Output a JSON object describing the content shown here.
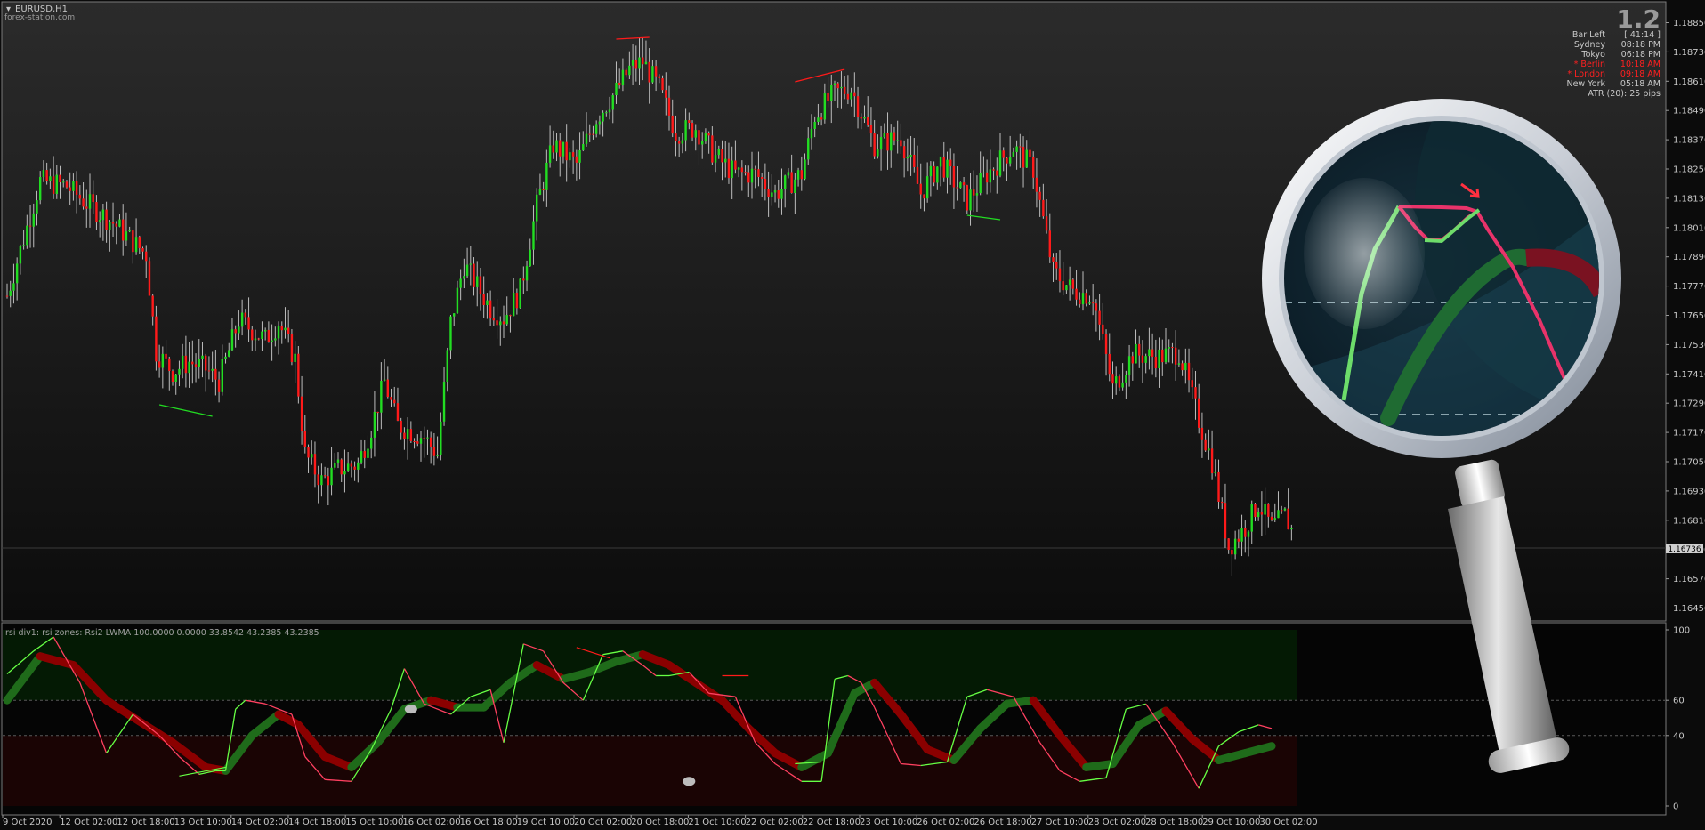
{
  "chart_title": "EURUSD,H1",
  "watermark": "forex-station.com",
  "version": "1.2",
  "info_panel": {
    "rows": [
      {
        "label": "Bar Left",
        "value": "[ 41:14 ]",
        "color": "#c8c8c8"
      },
      {
        "label": "Sydney",
        "value": "08:18 PM",
        "color": "#c8c8c8"
      },
      {
        "label": "Tokyo",
        "value": "06:18 PM",
        "color": "#c8c8c8"
      },
      {
        "label": "* Berlin",
        "value": "10:18 AM",
        "color": "#ff2020"
      },
      {
        "label": "* London",
        "value": "09:18 AM",
        "color": "#ff2020"
      },
      {
        "label": "New York",
        "value": "05:18 AM",
        "color": "#c8c8c8"
      }
    ],
    "atr": "ATR (20): 25 pips"
  },
  "current_price": "1.16736",
  "indicator_label": "rsi div1: rsi zones: Rsi2 LWMA 100.0000 0.0000 33.8542 43.2385 43.2385",
  "colors": {
    "bull": "#22dd22",
    "bear": "#ff1a1a",
    "rsi_fast": "#ff4060",
    "rsi_fast_up": "#66ff44",
    "rsi_slow_up": "#1f6b1a",
    "rsi_slow_down": "#8b0000",
    "bg_green_zone": "#041a04",
    "bg_red_zone": "#1a0404"
  },
  "chart_data": [
    {
      "type": "candlestick",
      "title": "EURUSD,H1",
      "y_ticks": [
        "1.18850",
        "1.18730",
        "1.18610",
        "1.18490",
        "1.18370",
        "1.18250",
        "1.18130",
        "1.18010",
        "1.17890",
        "1.17770",
        "1.17650",
        "1.17530",
        "1.17410",
        "1.17290",
        "1.17170",
        "1.17050",
        "1.16930",
        "1.16810",
        "1.16690",
        "1.16570",
        "1.16450"
      ],
      "ylim": [
        1.1645,
        1.1885
      ],
      "anchors": [
        [
          0,
          1.1773
        ],
        [
          10,
          1.182
        ],
        [
          18,
          1.1818
        ],
        [
          24,
          1.1811
        ],
        [
          32,
          1.1803
        ],
        [
          42,
          1.179
        ],
        [
          45,
          1.175
        ],
        [
          50,
          1.1742
        ],
        [
          55,
          1.1746
        ],
        [
          60,
          1.1743
        ],
        [
          64,
          1.1738
        ],
        [
          70,
          1.1763
        ],
        [
          78,
          1.1755
        ],
        [
          82,
          1.1762
        ],
        [
          87,
          1.1747
        ],
        [
          90,
          1.1708
        ],
        [
          95,
          1.1697
        ],
        [
          100,
          1.1702
        ],
        [
          106,
          1.1704
        ],
        [
          110,
          1.1719
        ],
        [
          114,
          1.1738
        ],
        [
          118,
          1.172
        ],
        [
          126,
          1.1715
        ],
        [
          130,
          1.1708
        ],
        [
          134,
          1.1762
        ],
        [
          138,
          1.1786
        ],
        [
          146,
          1.1768
        ],
        [
          150,
          1.1764
        ],
        [
          155,
          1.1775
        ],
        [
          160,
          1.181
        ],
        [
          165,
          1.1835
        ],
        [
          172,
          1.1827
        ],
        [
          178,
          1.1846
        ],
        [
          184,
          1.1857
        ],
        [
          188,
          1.1866
        ],
        [
          192,
          1.1869
        ],
        [
          197,
          1.1858
        ],
        [
          202,
          1.184
        ],
        [
          208,
          1.1842
        ],
        [
          214,
          1.183
        ],
        [
          220,
          1.1823
        ],
        [
          226,
          1.1823
        ],
        [
          232,
          1.1815
        ],
        [
          240,
          1.1823
        ],
        [
          244,
          1.1847
        ],
        [
          250,
          1.1856
        ],
        [
          255,
          1.1858
        ],
        [
          262,
          1.1835
        ],
        [
          270,
          1.1838
        ],
        [
          276,
          1.1815
        ],
        [
          282,
          1.1828
        ],
        [
          290,
          1.1812
        ],
        [
          296,
          1.1823
        ],
        [
          304,
          1.1834
        ],
        [
          310,
          1.1825
        ],
        [
          316,
          1.1783
        ],
        [
          322,
          1.1775
        ],
        [
          328,
          1.1773
        ],
        [
          334,
          1.1735
        ],
        [
          340,
          1.1749
        ],
        [
          348,
          1.1748
        ],
        [
          354,
          1.175
        ],
        [
          360,
          1.1722
        ],
        [
          364,
          1.1705
        ],
        [
          369,
          1.167
        ],
        [
          374,
          1.1678
        ],
        [
          378,
          1.1688
        ],
        [
          382,
          1.1678
        ],
        [
          386,
          1.1683
        ],
        [
          388,
          1.1677
        ]
      ],
      "last_price": "1.16736"
    },
    {
      "type": "line",
      "title": "rsi div1: rsi zones: Rsi2 LWMA 100.0000 0.0000 33.8542 43.2385 43.2385",
      "ylim": [
        0,
        100
      ],
      "y_ticks": [
        "100",
        "60",
        "40",
        "0"
      ],
      "levels": [
        60,
        40
      ],
      "x_ticks": [
        "9 Oct 2020",
        "12 Oct 02:00",
        "12 Oct 18:00",
        "13 Oct 10:00",
        "14 Oct 02:00",
        "14 Oct 18:00",
        "15 Oct 10:00",
        "16 Oct 02:00",
        "16 Oct 18:00",
        "19 Oct 10:00",
        "20 Oct 02:00",
        "20 Oct 18:00",
        "21 Oct 10:00",
        "22 Oct 02:00",
        "22 Oct 18:00",
        "23 Oct 10:00",
        "26 Oct 02:00",
        "26 Oct 18:00",
        "27 Oct 10:00",
        "28 Oct 02:00",
        "28 Oct 18:00",
        "29 Oct 10:00",
        "30 Oct 02:00"
      ],
      "rsi_fast": [
        [
          0,
          75
        ],
        [
          8,
          88
        ],
        [
          14,
          96
        ],
        [
          22,
          70
        ],
        [
          30,
          30
        ],
        [
          38,
          52
        ],
        [
          46,
          40
        ],
        [
          52,
          28
        ],
        [
          58,
          18
        ],
        [
          63,
          20
        ],
        [
          66,
          20
        ],
        [
          69,
          55
        ],
        [
          72,
          60
        ],
        [
          78,
          58
        ],
        [
          86,
          52
        ],
        [
          90,
          28
        ],
        [
          96,
          15
        ],
        [
          104,
          14
        ],
        [
          110,
          32
        ],
        [
          116,
          55
        ],
        [
          120,
          78
        ],
        [
          126,
          58
        ],
        [
          134,
          52
        ],
        [
          140,
          62
        ],
        [
          146,
          66
        ],
        [
          150,
          36
        ],
        [
          156,
          92
        ],
        [
          162,
          88
        ],
        [
          168,
          70
        ],
        [
          174,
          60
        ],
        [
          180,
          86
        ],
        [
          186,
          88
        ],
        [
          192,
          80
        ],
        [
          196,
          74
        ],
        [
          200,
          74
        ],
        [
          206,
          76
        ],
        [
          212,
          64
        ],
        [
          220,
          62
        ],
        [
          226,
          36
        ],
        [
          232,
          24
        ],
        [
          240,
          14
        ],
        [
          246,
          14
        ],
        [
          250,
          72
        ],
        [
          254,
          74
        ],
        [
          258,
          70
        ],
        [
          262,
          56
        ],
        [
          270,
          24
        ],
        [
          276,
          23
        ],
        [
          284,
          25
        ],
        [
          290,
          62
        ],
        [
          296,
          66
        ],
        [
          304,
          62
        ],
        [
          312,
          36
        ],
        [
          318,
          20
        ],
        [
          324,
          14
        ],
        [
          332,
          16
        ],
        [
          338,
          55
        ],
        [
          344,
          58
        ],
        [
          352,
          36
        ],
        [
          360,
          10
        ],
        [
          366,
          34
        ],
        [
          372,
          42
        ],
        [
          378,
          46
        ],
        [
          382,
          44
        ]
      ],
      "rsi_fast_up": [
        [
          0,
          75
        ],
        [
          8,
          88
        ],
        [
          14,
          96
        ],
        [
          22,
          70
        ],
        [
          30,
          30
        ],
        [
          38,
          52
        ],
        [
          46,
          40
        ],
        [
          52,
          28
        ],
        [
          58,
          18
        ],
        [
          63,
          20
        ],
        [
          66,
          20
        ],
        [
          69,
          55
        ],
        [
          72,
          60
        ],
        [
          78,
          58
        ],
        [
          86,
          52
        ],
        [
          90,
          28
        ],
        [
          96,
          15
        ],
        [
          104,
          14
        ],
        [
          110,
          32
        ],
        [
          116,
          55
        ],
        [
          120,
          78
        ],
        [
          126,
          58
        ],
        [
          134,
          52
        ],
        [
          140,
          62
        ],
        [
          146,
          66
        ],
        [
          150,
          36
        ],
        [
          156,
          92
        ],
        [
          162,
          88
        ],
        [
          168,
          70
        ],
        [
          174,
          60
        ],
        [
          180,
          86
        ],
        [
          186,
          88
        ],
        [
          192,
          80
        ],
        [
          196,
          74
        ],
        [
          200,
          74
        ],
        [
          206,
          76
        ],
        [
          212,
          64
        ],
        [
          220,
          62
        ],
        [
          226,
          36
        ],
        [
          232,
          24
        ],
        [
          240,
          14
        ],
        [
          246,
          14
        ],
        [
          250,
          72
        ],
        [
          254,
          74
        ],
        [
          258,
          70
        ],
        [
          262,
          56
        ],
        [
          270,
          24
        ],
        [
          276,
          23
        ],
        [
          284,
          25
        ],
        [
          290,
          62
        ],
        [
          296,
          66
        ],
        [
          304,
          62
        ],
        [
          312,
          36
        ],
        [
          318,
          20
        ],
        [
          324,
          14
        ],
        [
          332,
          16
        ],
        [
          338,
          55
        ],
        [
          344,
          58
        ],
        [
          352,
          36
        ],
        [
          360,
          10
        ],
        [
          366,
          34
        ],
        [
          372,
          42
        ],
        [
          378,
          46
        ],
        [
          382,
          44
        ]
      ],
      "rsi_slow": [
        [
          0,
          60
        ],
        [
          10,
          85
        ],
        [
          20,
          80
        ],
        [
          30,
          60
        ],
        [
          40,
          48
        ],
        [
          50,
          36
        ],
        [
          60,
          22
        ],
        [
          66,
          20
        ],
        [
          74,
          40
        ],
        [
          82,
          52
        ],
        [
          88,
          46
        ],
        [
          96,
          28
        ],
        [
          104,
          22
        ],
        [
          112,
          36
        ],
        [
          120,
          55
        ],
        [
          128,
          60
        ],
        [
          136,
          56
        ],
        [
          144,
          56
        ],
        [
          152,
          70
        ],
        [
          160,
          80
        ],
        [
          168,
          72
        ],
        [
          176,
          76
        ],
        [
          184,
          82
        ],
        [
          192,
          86
        ],
        [
          200,
          80
        ],
        [
          208,
          70
        ],
        [
          216,
          60
        ],
        [
          224,
          44
        ],
        [
          232,
          30
        ],
        [
          240,
          22
        ],
        [
          248,
          30
        ],
        [
          256,
          64
        ],
        [
          262,
          70
        ],
        [
          270,
          52
        ],
        [
          278,
          32
        ],
        [
          286,
          26
        ],
        [
          294,
          44
        ],
        [
          302,
          58
        ],
        [
          310,
          60
        ],
        [
          318,
          40
        ],
        [
          326,
          22
        ],
        [
          334,
          24
        ],
        [
          342,
          46
        ],
        [
          350,
          54
        ],
        [
          358,
          38
        ],
        [
          366,
          26
        ],
        [
          374,
          30
        ],
        [
          382,
          34
        ]
      ]
    }
  ],
  "magnifier": {
    "note": ""
  }
}
